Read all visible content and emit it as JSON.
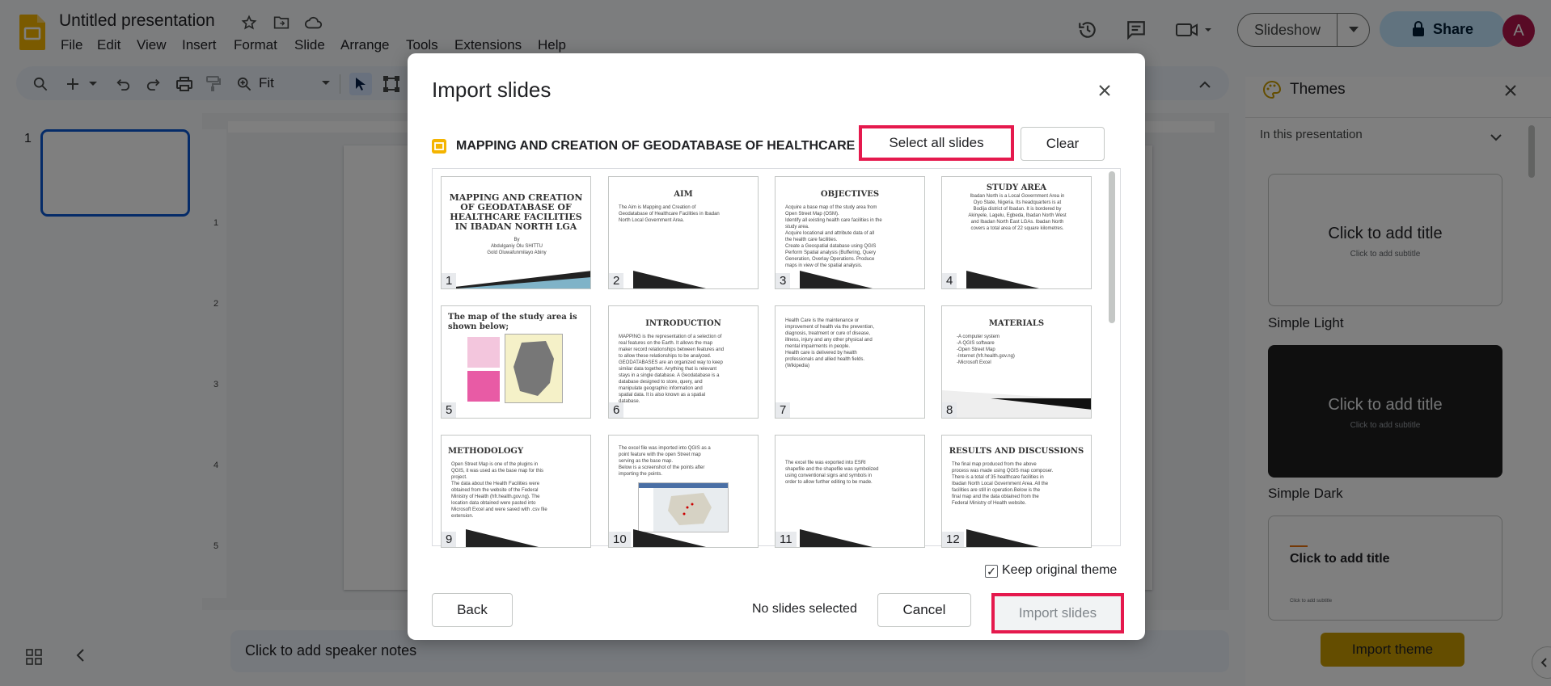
{
  "app": {
    "title": "Untitled presentation"
  },
  "menu": [
    "File",
    "Edit",
    "View",
    "Insert",
    "Format",
    "Slide",
    "Arrange",
    "Tools",
    "Extensions",
    "Help"
  ],
  "toolbar": {
    "zoom": "Fit"
  },
  "header": {
    "slideshow_label": "Slideshow",
    "share_label": "Share",
    "avatar_initial": "A"
  },
  "filmstrip": {
    "slide_number": "1"
  },
  "canvas": {
    "speaker_notes_placeholder": "Click to add speaker notes"
  },
  "themes": {
    "title": "Themes",
    "filter": "In this presentation",
    "cards": [
      {
        "name": "Simple Light",
        "title": "Click to add title",
        "subtitle": "Click to add subtitle"
      },
      {
        "name": "Simple Dark",
        "title": "Click to add title",
        "subtitle": "Click to add subtitle"
      },
      {
        "name": "",
        "title": "Click to add title",
        "subtitle": "Click to add subtitle"
      }
    ],
    "import_label": "Import theme"
  },
  "dialog": {
    "title": "Import slides",
    "presentation_name": "MAPPING AND CREATION OF GEODATABASE OF HEALTHCARE FA",
    "select_all_label": "Select all slides",
    "clear_label": "Clear",
    "keep_theme_label": "Keep original theme",
    "keep_theme_checked": true,
    "back_label": "Back",
    "status": "No slides selected",
    "cancel_label": "Cancel",
    "import_label": "Import slides",
    "slides": [
      {
        "n": "1",
        "title": "MAPPING AND CREATION\nOF GEODATABASE OF\nHEALTHCARE FACILITIES\nIN IBADAN NORTH LGA",
        "body": "By\nAbdulganiy Olu SHITTU\nGold Oluwafunmilayo Abiny"
      },
      {
        "n": "2",
        "title": "AIM",
        "body": "The Aim is Mapping and Creation of\nGeodatabase of Healthcare Facilities in Ibadan\nNorth Local Government Area."
      },
      {
        "n": "3",
        "title": "OBJECTIVES",
        "body": "Acquire a base map of the study area from\nOpen Street Map (OSM).\nIdentify all existing health care facilities in the\nstudy area.\nAcquire locational and attribute data of all\nthe health care facilities.\nCreate a Geospatial database using QGIS\nPerform Spatial analysis (Buffering, Query\nGeneration, Overlay Operations. Produce\nmaps in view of the spatial analysis."
      },
      {
        "n": "4",
        "title": "STUDY AREA",
        "body": "Ibadan North is a Local Government Area in\nOyo State, Nigeria. Its headquarters is at\nBodija district of Ibadan. It is bordered by\nAkinyele, Lagelu, Egbeda, Ibadan North West\nand Ibadan North East LGAs. Ibadan North\ncovers a total area of 22 square kilometres."
      },
      {
        "n": "5",
        "title": "The map of the study area is\nshown below;",
        "body": ""
      },
      {
        "n": "6",
        "title": "INTRODUCTION",
        "body": "MAPPING is the representation of a selection of\nreal features on the Earth. It allows the map\nmaker record relationships between features and\nto allow these relationships to be analyzed.\nGEODATABASES are an organized way to keep\nsimilar data together. Anything that is relevant\nstays in a single database. A Geodatabase is a\ndatabase designed to store, query, and\nmanipulate geographic information and\nspatial data. It is also known as a spatial\ndatabase."
      },
      {
        "n": "7",
        "title": "",
        "body": "Health Care is the maintenance or\nimprovement of health via the prevention,\ndiagnosis, treatment or cure of disease,\nillness, injury and any other physical and\nmental impairments in people.\nHealth care is delivered by health\nprofessionals and allied health fields.\n(Wikipedia)"
      },
      {
        "n": "8",
        "title": "MATERIALS",
        "body": "-A computer system\n-A QGIS software\n-Open Street Map\n-Internet (hfr.health.gov.ng)\n-Microsoft Excel"
      },
      {
        "n": "9",
        "title": "METHODOLOGY",
        "body": "Open Street Map is one of the plugins in\nQGIS, it was used as the base map for this\nproject.\nThe data about the Health Facilities were\nobtained from the website of the Federal\nMinistry of Health (hfr.health.gov.ng). The\nlocation data obtained were pasted into\nMicrosoft Excel and were saved with .csv file\nextension."
      },
      {
        "n": "10",
        "title": "",
        "body": "The excel file was imported into QGIS as a\npoint feature with the open Street map\nserving as the base map.\nBelow is a screenshot of the points after\nimporting the points."
      },
      {
        "n": "11",
        "title": "",
        "body": "The excel file was exported into ESRI\nshapefile and the shapefile was symbolized\nusing conventional signs and symbols in\norder to allow further editing to be made."
      },
      {
        "n": "12",
        "title": "RESULTS AND DISCUSSIONS",
        "body": "The final map produced from the above\nprocess was made using QGIS map composer.\nThere is a total of 35 healthcare facilities in\nIbadan North Local Government Area. All the\nfacilities are still in operation.Below is the\nfinal map and the data obtained from the\nFederal Ministry of Health website."
      }
    ]
  }
}
